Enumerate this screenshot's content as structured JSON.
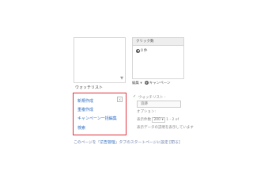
{
  "top_right_panel": {
    "header": "クリック数",
    "row_label": "0",
    "row_suffix": "件"
  },
  "watchlist_label": "ウォッチリスト",
  "toolbar": {
    "edit_label": "編集 ▾",
    "campaign_label": "キャンペーン"
  },
  "menu": {
    "items": [
      "新規作成",
      "重複作成",
      "キャンペーン一括編集",
      "検索"
    ],
    "close_label": "x"
  },
  "right_box": {
    "title": "ウォッチリスト -",
    "input_value": "追跡",
    "row1_label": "オプション:",
    "row2_label": "表示件数",
    "row2_select": "200 ▾",
    "row2_suffix": "1 - 2 of",
    "row3_label": "表示データの説明を表示しています"
  },
  "footer": {
    "prefix": "このページを「",
    "link": "広告管理",
    "suffix": "」タブのスタートページに設定 [閉る]"
  }
}
